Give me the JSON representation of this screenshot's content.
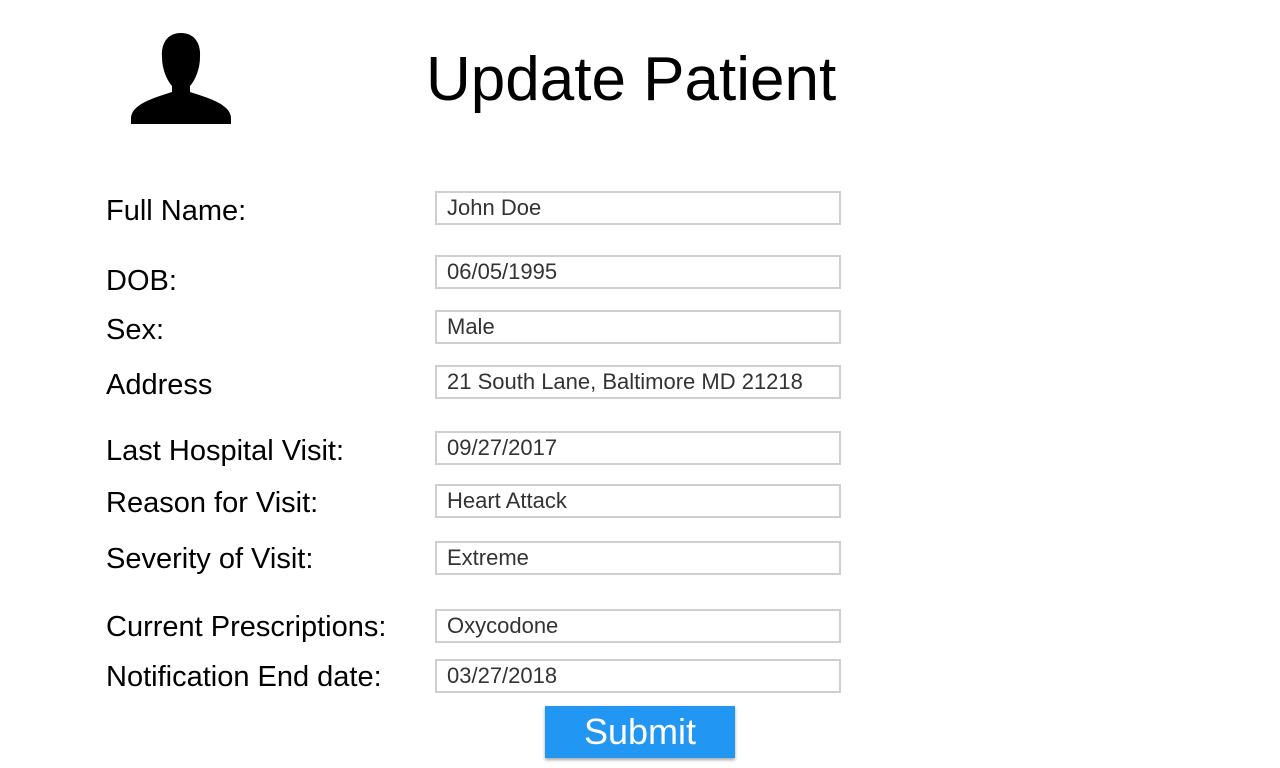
{
  "avatar": {
    "icon": "person-silhouette-icon"
  },
  "title": "Update Patient",
  "form": {
    "full_name": {
      "label": "Full Name:",
      "value": "John Doe"
    },
    "dob": {
      "label": "DOB:",
      "value": "06/05/1995"
    },
    "sex": {
      "label": "Sex:",
      "value": "Male"
    },
    "address": {
      "label": "Address",
      "value": "21 South Lane, Baltimore MD 21218"
    },
    "last_visit": {
      "label": "Last Hospital Visit:",
      "value": "09/27/2017"
    },
    "reason": {
      "label": "Reason for Visit:",
      "value": "Heart Attack"
    },
    "severity": {
      "label": "Severity of Visit:",
      "value": "Extreme"
    },
    "prescriptions": {
      "label": "Current Prescriptions:",
      "value": "Oxycodone"
    },
    "notification_end": {
      "label": "Notification End date:",
      "value": "03/27/2018"
    }
  },
  "submit_label": "Submit",
  "colors": {
    "accent": "#2196f3",
    "field_border": "#cfcfcf"
  }
}
